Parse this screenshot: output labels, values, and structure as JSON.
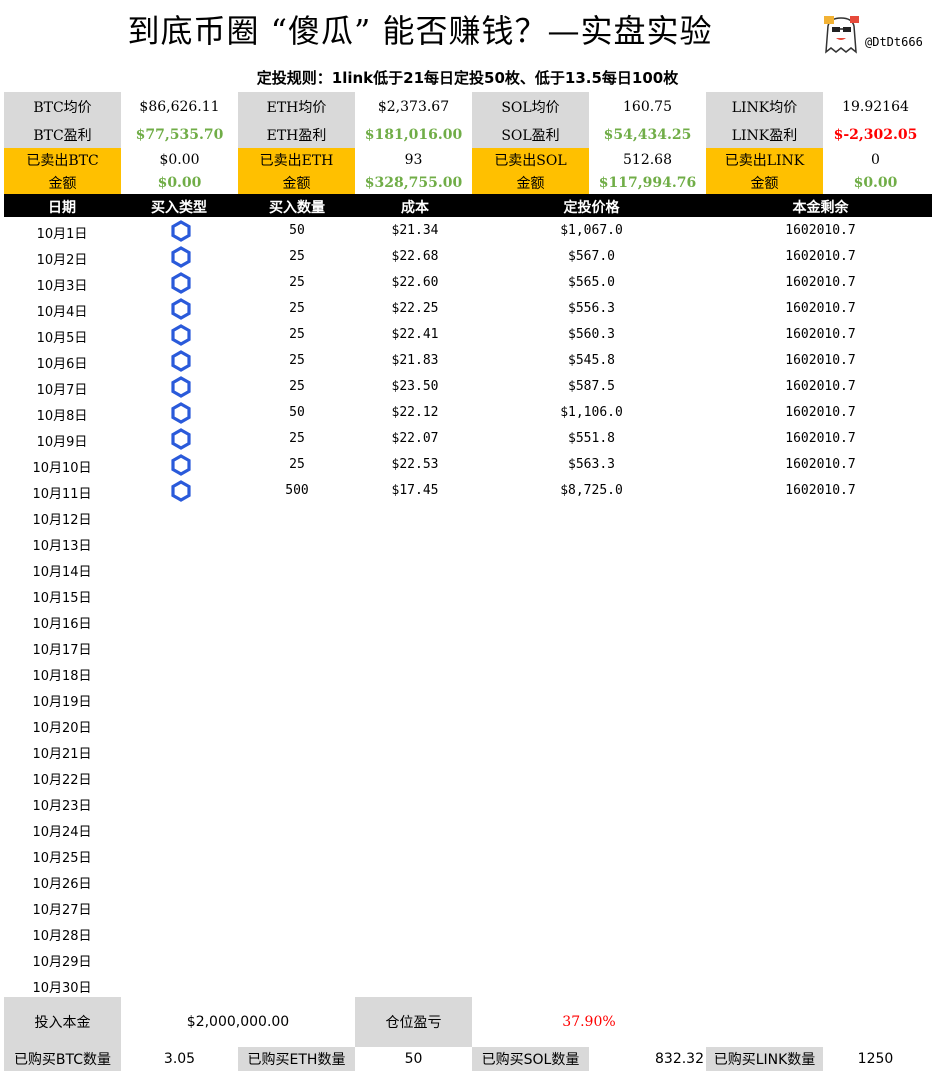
{
  "title": "到底币圈 “傻瓜” 能否赚钱？—实盘实验",
  "handle": "@DtDt666",
  "rule": "定投规则：1link低于21每日定投50枚、低于13.5每日100枚",
  "stats": {
    "row1": [
      "BTC均价",
      "$86,626.11",
      "ETH均价",
      "$2,373.67",
      "SOL均价",
      "160.75",
      "LINK均价",
      "19.92164"
    ],
    "row2": [
      "BTC盈利",
      "$77,535.70",
      "ETH盈利",
      "$181,016.00",
      "SOL盈利",
      "$54,434.25",
      "LINK盈利",
      "$-2,302.05"
    ],
    "row3": [
      "已卖出BTC",
      "$0.00",
      "已卖出ETH",
      "93",
      "已卖出SOL",
      "512.68",
      "已卖出LINK",
      "0"
    ],
    "row4": [
      "金额",
      "$0.00",
      "金额",
      "$328,755.00",
      "金额",
      "$117,994.76",
      "金额",
      "$0.00"
    ]
  },
  "colors": {
    "label_bg": "#d9d9d9",
    "sold_bg": "#ffc000",
    "profit": "#70ad47",
    "loss": "#ff0000",
    "link_icon": "#2a5ada"
  },
  "table": {
    "headers": [
      "日期",
      "买入类型",
      "买入数量",
      "成本",
      "定投价格",
      "本金剩余"
    ],
    "rows": [
      {
        "date": "10月1日",
        "type_icon": "chainlink-icon",
        "qty": "50",
        "cost": "$21.34",
        "price": "$1,067.0",
        "remaining": "1602010.7"
      },
      {
        "date": "10月2日",
        "type_icon": "chainlink-icon",
        "qty": "25",
        "cost": "$22.68",
        "price": "$567.0",
        "remaining": "1602010.7"
      },
      {
        "date": "10月3日",
        "type_icon": "chainlink-icon",
        "qty": "25",
        "cost": "$22.60",
        "price": "$565.0",
        "remaining": "1602010.7"
      },
      {
        "date": "10月4日",
        "type_icon": "chainlink-icon",
        "qty": "25",
        "cost": "$22.25",
        "price": "$556.3",
        "remaining": "1602010.7"
      },
      {
        "date": "10月5日",
        "type_icon": "chainlink-icon",
        "qty": "25",
        "cost": "$22.41",
        "price": "$560.3",
        "remaining": "1602010.7"
      },
      {
        "date": "10月6日",
        "type_icon": "chainlink-icon",
        "qty": "25",
        "cost": "$21.83",
        "price": "$545.8",
        "remaining": "1602010.7"
      },
      {
        "date": "10月7日",
        "type_icon": "chainlink-icon",
        "qty": "25",
        "cost": "$23.50",
        "price": "$587.5",
        "remaining": "1602010.7"
      },
      {
        "date": "10月8日",
        "type_icon": "chainlink-icon",
        "qty": "50",
        "cost": "$22.12",
        "price": "$1,106.0",
        "remaining": "1602010.7"
      },
      {
        "date": "10月9日",
        "type_icon": "chainlink-icon",
        "qty": "25",
        "cost": "$22.07",
        "price": "$551.8",
        "remaining": "1602010.7"
      },
      {
        "date": "10月10日",
        "type_icon": "chainlink-icon",
        "qty": "25",
        "cost": "$22.53",
        "price": "$563.3",
        "remaining": "1602010.7"
      },
      {
        "date": "10月11日",
        "type_icon": "chainlink-icon",
        "qty": "500",
        "cost": "$17.45",
        "price": "$8,725.0",
        "remaining": "1602010.7"
      },
      {
        "date": "10月12日"
      },
      {
        "date": "10月13日"
      },
      {
        "date": "10月14日"
      },
      {
        "date": "10月15日"
      },
      {
        "date": "10月16日"
      },
      {
        "date": "10月17日"
      },
      {
        "date": "10月18日"
      },
      {
        "date": "10月19日"
      },
      {
        "date": "10月20日"
      },
      {
        "date": "10月21日"
      },
      {
        "date": "10月22日"
      },
      {
        "date": "10月23日"
      },
      {
        "date": "10月24日"
      },
      {
        "date": "10月25日"
      },
      {
        "date": "10月26日"
      },
      {
        "date": "10月27日"
      },
      {
        "date": "10月28日"
      },
      {
        "date": "10月29日"
      },
      {
        "date": "10月30日"
      }
    ]
  },
  "bottom": {
    "invest_label": "投入本金",
    "invest_value": "$2,000,000.00",
    "pnl_label": "仓位盈亏",
    "pnl_value": "37.90%",
    "btc_label": "已购买BTC数量",
    "btc_value": "3.05",
    "eth_label": "已购买ETH数量",
    "eth_value": "50",
    "sol_label": "已购买SOL数量",
    "sol_value": "832.32",
    "link_label": "已购买LINK数量",
    "link_value": "1250"
  }
}
